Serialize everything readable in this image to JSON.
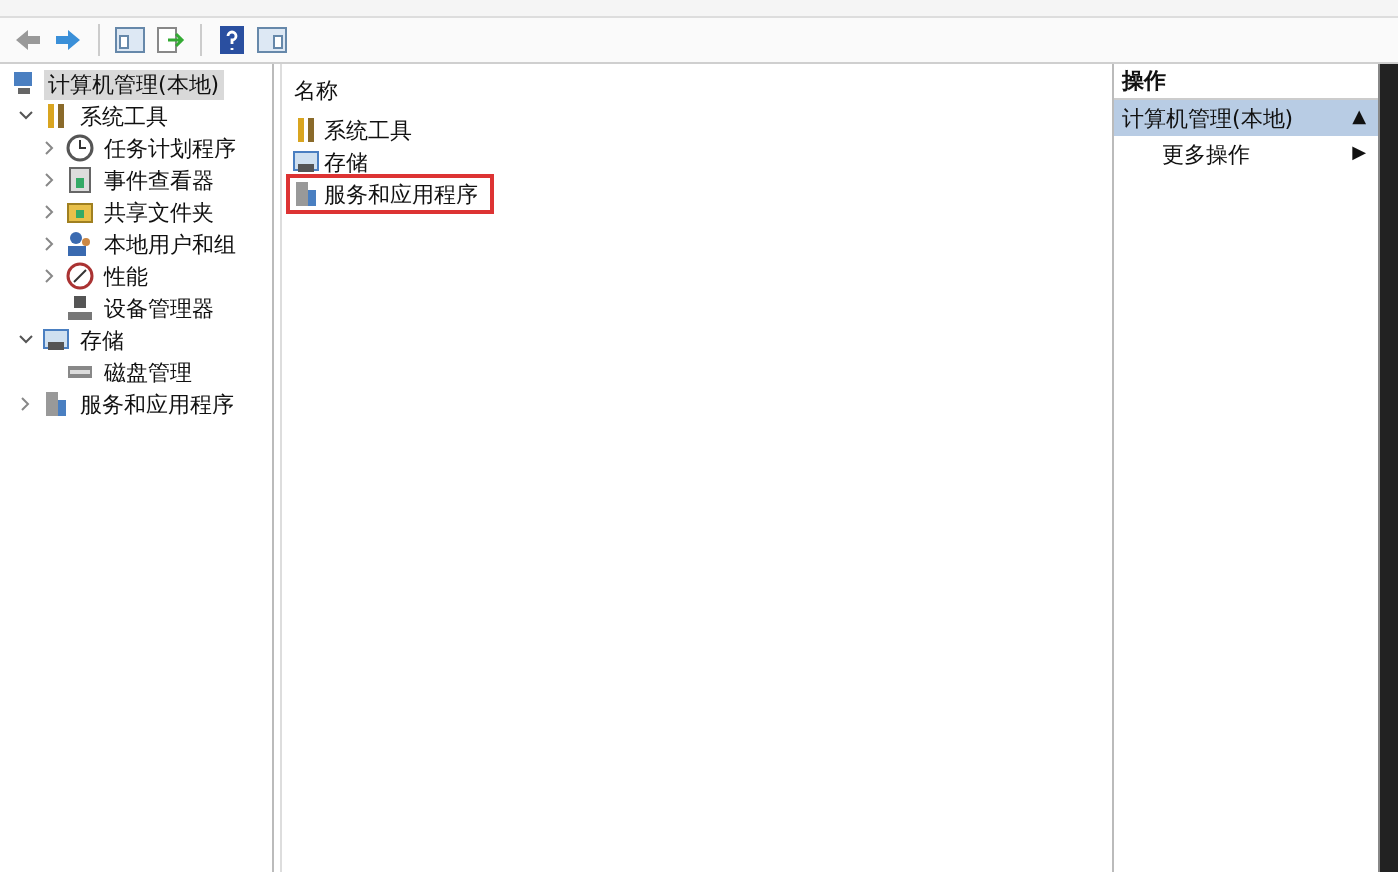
{
  "tree": [
    {
      "label": "计算机管理(本地)",
      "kind": "root",
      "selected": true,
      "children": [
        {
          "label": "系统工具",
          "kind": "branch",
          "expanded": true,
          "selected": false,
          "children": [
            {
              "label": "任务计划程序",
              "kind": "branch",
              "expanded": false,
              "selected": false
            },
            {
              "label": "事件查看器",
              "kind": "branch",
              "expanded": false,
              "selected": false
            },
            {
              "label": "共享文件夹",
              "kind": "branch",
              "expanded": false,
              "selected": false
            },
            {
              "label": "本地用户和组",
              "kind": "branch",
              "expanded": false,
              "selected": false
            },
            {
              "label": "性能",
              "kind": "branch",
              "expanded": false,
              "selected": false
            },
            {
              "label": "设备管理器",
              "kind": "leaf",
              "selected": false
            }
          ]
        },
        {
          "label": "存储",
          "kind": "branch",
          "expanded": true,
          "selected": false,
          "children": [
            {
              "label": "磁盘管理",
              "kind": "leaf",
              "selected": false
            }
          ]
        },
        {
          "label": "服务和应用程序",
          "kind": "branch",
          "expanded": false,
          "selected": false
        }
      ]
    }
  ],
  "list": {
    "column": "名称",
    "items": [
      {
        "label": "系统工具",
        "highlighted": false
      },
      {
        "label": "存储",
        "highlighted": false
      },
      {
        "label": "服务和应用程序",
        "highlighted": true
      }
    ]
  },
  "actions": {
    "title": "操作",
    "section": {
      "label": "计算机管理(本地)",
      "arrow": "▲"
    },
    "items": [
      {
        "label": "更多操作",
        "arrow": "▶"
      }
    ]
  }
}
